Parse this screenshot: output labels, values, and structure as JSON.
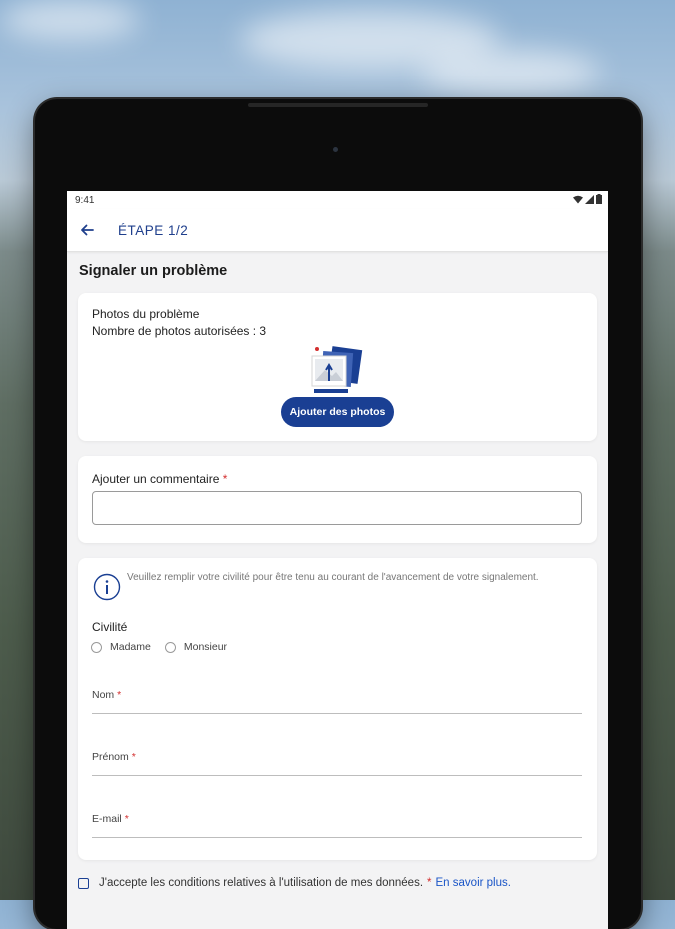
{
  "status_bar": {
    "time": "9:41"
  },
  "app_bar": {
    "title": "ÉTAPE 1/2"
  },
  "page": {
    "title": "Signaler un problème"
  },
  "photos": {
    "title": "Photos du problème",
    "subtitle": "Nombre de photos autorisées : 3",
    "add_button": "Ajouter des photos"
  },
  "comment": {
    "label": "Ajouter un commentaire",
    "required_mark": "*",
    "value": ""
  },
  "info": {
    "text": "Veuillez remplir votre civilité pour être tenu au courant de l'avancement de votre signalement."
  },
  "civility": {
    "label": "Civilité",
    "options": [
      "Madame",
      "Monsieur"
    ]
  },
  "fields": {
    "nom": "Nom",
    "prenom": "Prénom",
    "email": "E-mail",
    "required_mark": "*"
  },
  "consent": {
    "text": "J'accepte les conditions relatives à l'utilisation de mes données.",
    "required_mark": "*",
    "link": "En savoir plus."
  },
  "colors": {
    "primary": "#1a3f93",
    "link": "#1a55c7",
    "required": "#d32f2f"
  }
}
